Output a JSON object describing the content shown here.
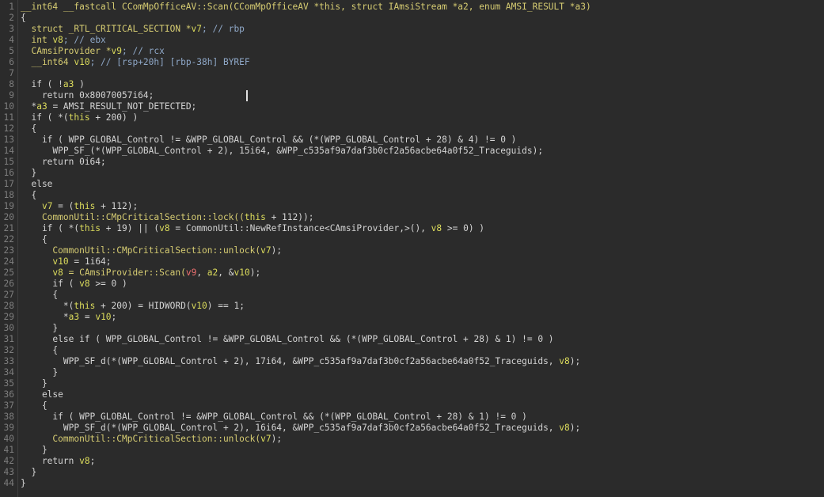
{
  "editor": {
    "colors": {
      "background": "#2b2b2b",
      "default_text": "#d4d4d4",
      "keyword": "#d6cc72",
      "variable": "#dcdc5c",
      "comment": "#8fa8c8",
      "argument": "#f07070",
      "line_number": "#7e7e7e"
    },
    "lines": [
      {
        "num": "1",
        "tokens": [
          {
            "t": "__int64 __fastcall CComMpOfficeAV::Scan(CComMpOfficeAV *this, struct IAmsiStream *a2, enum AMSI_RESULT *a3)",
            "c": "tok-kw"
          }
        ]
      },
      {
        "num": "2",
        "tokens": [
          {
            "t": "{",
            "c": "tok-plain"
          }
        ]
      },
      {
        "num": "3",
        "tokens": [
          {
            "t": "  struct _RTL_CRITICAL_SECTION *",
            "c": "tok-kw"
          },
          {
            "t": "v7",
            "c": "tok-var"
          },
          {
            "t": "; // rbp",
            "c": "tok-comment"
          }
        ]
      },
      {
        "num": "4",
        "tokens": [
          {
            "t": "  int ",
            "c": "tok-kw"
          },
          {
            "t": "v8",
            "c": "tok-var"
          },
          {
            "t": "; // ebx",
            "c": "tok-comment"
          }
        ]
      },
      {
        "num": "5",
        "tokens": [
          {
            "t": "  CAmsiProvider *",
            "c": "tok-kw"
          },
          {
            "t": "v9",
            "c": "tok-var"
          },
          {
            "t": "; // rcx",
            "c": "tok-comment"
          }
        ]
      },
      {
        "num": "6",
        "tokens": [
          {
            "t": "  __int64 ",
            "c": "tok-kw"
          },
          {
            "t": "v10",
            "c": "tok-var"
          },
          {
            "t": "; // [rsp+20h] [rbp-38h] BYREF",
            "c": "tok-comment"
          }
        ]
      },
      {
        "num": "7",
        "tokens": [
          {
            "t": "",
            "c": "tok-plain"
          }
        ]
      },
      {
        "num": "8",
        "tokens": [
          {
            "t": "  if ( !",
            "c": "tok-plain"
          },
          {
            "t": "a3",
            "c": "tok-var"
          },
          {
            "t": " )",
            "c": "tok-plain"
          }
        ]
      },
      {
        "num": "9",
        "tokens": [
          {
            "t": "    return 0x80070057i64;",
            "c": "tok-plain"
          }
        ]
      },
      {
        "num": "10",
        "tokens": [
          {
            "t": "  *",
            "c": "tok-plain"
          },
          {
            "t": "a3",
            "c": "tok-var"
          },
          {
            "t": " = AMSI_RESULT_NOT_DETECTED;",
            "c": "tok-plain"
          }
        ]
      },
      {
        "num": "11",
        "tokens": [
          {
            "t": "  if ( *(",
            "c": "tok-plain"
          },
          {
            "t": "this",
            "c": "tok-var"
          },
          {
            "t": " + 200) )",
            "c": "tok-plain"
          }
        ]
      },
      {
        "num": "12",
        "tokens": [
          {
            "t": "  {",
            "c": "tok-plain"
          }
        ]
      },
      {
        "num": "13",
        "tokens": [
          {
            "t": "    if ( WPP_GLOBAL_Control != &WPP_GLOBAL_Control && (*(WPP_GLOBAL_Control + 28) & 4) != 0 )",
            "c": "tok-plain"
          }
        ]
      },
      {
        "num": "14",
        "tokens": [
          {
            "t": "      WPP_SF_(*(WPP_GLOBAL_Control + 2), 15i64, &WPP_c535af9a7daf3b0cf2a56acbe64a0f52_Traceguids);",
            "c": "tok-plain"
          }
        ]
      },
      {
        "num": "15",
        "tokens": [
          {
            "t": "    return 0i64;",
            "c": "tok-plain"
          }
        ]
      },
      {
        "num": "16",
        "tokens": [
          {
            "t": "  }",
            "c": "tok-plain"
          }
        ]
      },
      {
        "num": "17",
        "tokens": [
          {
            "t": "  else",
            "c": "tok-plain"
          }
        ]
      },
      {
        "num": "18",
        "tokens": [
          {
            "t": "  {",
            "c": "tok-plain"
          }
        ]
      },
      {
        "num": "19",
        "tokens": [
          {
            "t": "    ",
            "c": "tok-plain"
          },
          {
            "t": "v7",
            "c": "tok-var"
          },
          {
            "t": " = (",
            "c": "tok-plain"
          },
          {
            "t": "this",
            "c": "tok-var"
          },
          {
            "t": " + 112);",
            "c": "tok-plain"
          }
        ]
      },
      {
        "num": "20",
        "tokens": [
          {
            "t": "    CommonUtil::CMpCriticalSection::lock((",
            "c": "tok-kw"
          },
          {
            "t": "this",
            "c": "tok-var"
          },
          {
            "t": " + 112));",
            "c": "tok-plain"
          }
        ]
      },
      {
        "num": "21",
        "tokens": [
          {
            "t": "    if ( *(",
            "c": "tok-plain"
          },
          {
            "t": "this",
            "c": "tok-var"
          },
          {
            "t": " + 19) || (",
            "c": "tok-plain"
          },
          {
            "t": "v8",
            "c": "tok-var"
          },
          {
            "t": " = CommonUtil::NewRefInstance<CAmsiProvider,>(), ",
            "c": "tok-plain"
          },
          {
            "t": "v8",
            "c": "tok-var"
          },
          {
            "t": " >= 0) )",
            "c": "tok-plain"
          }
        ]
      },
      {
        "num": "22",
        "tokens": [
          {
            "t": "    {",
            "c": "tok-plain"
          }
        ]
      },
      {
        "num": "23",
        "tokens": [
          {
            "t": "      CommonUtil::CMpCriticalSection::unlock(",
            "c": "tok-kw"
          },
          {
            "t": "v7",
            "c": "tok-var"
          },
          {
            "t": ");",
            "c": "tok-plain"
          }
        ]
      },
      {
        "num": "24",
        "tokens": [
          {
            "t": "      ",
            "c": "tok-plain"
          },
          {
            "t": "v10",
            "c": "tok-var"
          },
          {
            "t": " = 1i64;",
            "c": "tok-plain"
          }
        ]
      },
      {
        "num": "25",
        "tokens": [
          {
            "t": "      ",
            "c": "tok-plain"
          },
          {
            "t": "v8",
            "c": "tok-var"
          },
          {
            "t": " = CAmsiProvider::Scan(",
            "c": "tok-kw"
          },
          {
            "t": "v9",
            "c": "tok-arg"
          },
          {
            "t": ", ",
            "c": "tok-plain"
          },
          {
            "t": "a2",
            "c": "tok-var"
          },
          {
            "t": ", &",
            "c": "tok-plain"
          },
          {
            "t": "v10",
            "c": "tok-var"
          },
          {
            "t": ");",
            "c": "tok-plain"
          }
        ]
      },
      {
        "num": "26",
        "tokens": [
          {
            "t": "      if ( ",
            "c": "tok-plain"
          },
          {
            "t": "v8",
            "c": "tok-var"
          },
          {
            "t": " >= 0 )",
            "c": "tok-plain"
          }
        ]
      },
      {
        "num": "27",
        "tokens": [
          {
            "t": "      {",
            "c": "tok-plain"
          }
        ]
      },
      {
        "num": "28",
        "tokens": [
          {
            "t": "        *(",
            "c": "tok-plain"
          },
          {
            "t": "this",
            "c": "tok-var"
          },
          {
            "t": " + 200) = HIDWORD(",
            "c": "tok-plain"
          },
          {
            "t": "v10",
            "c": "tok-var"
          },
          {
            "t": ") == 1;",
            "c": "tok-plain"
          }
        ]
      },
      {
        "num": "29",
        "tokens": [
          {
            "t": "        *",
            "c": "tok-plain"
          },
          {
            "t": "a3",
            "c": "tok-var"
          },
          {
            "t": " = ",
            "c": "tok-plain"
          },
          {
            "t": "v10",
            "c": "tok-var"
          },
          {
            "t": ";",
            "c": "tok-plain"
          }
        ]
      },
      {
        "num": "30",
        "tokens": [
          {
            "t": "      }",
            "c": "tok-plain"
          }
        ]
      },
      {
        "num": "31",
        "tokens": [
          {
            "t": "      else if ( WPP_GLOBAL_Control != &WPP_GLOBAL_Control && (*(WPP_GLOBAL_Control + 28) & 1) != 0 )",
            "c": "tok-plain"
          }
        ]
      },
      {
        "num": "32",
        "tokens": [
          {
            "t": "      {",
            "c": "tok-plain"
          }
        ]
      },
      {
        "num": "33",
        "tokens": [
          {
            "t": "        WPP_SF_d(*(WPP_GLOBAL_Control + 2), 17i64, &WPP_c535af9a7daf3b0cf2a56acbe64a0f52_Traceguids, ",
            "c": "tok-plain"
          },
          {
            "t": "v8",
            "c": "tok-var"
          },
          {
            "t": ");",
            "c": "tok-plain"
          }
        ]
      },
      {
        "num": "34",
        "tokens": [
          {
            "t": "      }",
            "c": "tok-plain"
          }
        ]
      },
      {
        "num": "35",
        "tokens": [
          {
            "t": "    }",
            "c": "tok-plain"
          }
        ]
      },
      {
        "num": "36",
        "tokens": [
          {
            "t": "    else",
            "c": "tok-plain"
          }
        ]
      },
      {
        "num": "37",
        "tokens": [
          {
            "t": "    {",
            "c": "tok-plain"
          }
        ]
      },
      {
        "num": "38",
        "tokens": [
          {
            "t": "      if ( WPP_GLOBAL_Control != &WPP_GLOBAL_Control && (*(WPP_GLOBAL_Control + 28) & 1) != 0 )",
            "c": "tok-plain"
          }
        ]
      },
      {
        "num": "39",
        "tokens": [
          {
            "t": "        WPP_SF_d(*(WPP_GLOBAL_Control + 2), 16i64, &WPP_c535af9a7daf3b0cf2a56acbe64a0f52_Traceguids, ",
            "c": "tok-plain"
          },
          {
            "t": "v8",
            "c": "tok-var"
          },
          {
            "t": ");",
            "c": "tok-plain"
          }
        ]
      },
      {
        "num": "40",
        "tokens": [
          {
            "t": "      CommonUtil::CMpCriticalSection::unlock(",
            "c": "tok-kw"
          },
          {
            "t": "v7",
            "c": "tok-var"
          },
          {
            "t": ");",
            "c": "tok-plain"
          }
        ]
      },
      {
        "num": "41",
        "tokens": [
          {
            "t": "    }",
            "c": "tok-plain"
          }
        ]
      },
      {
        "num": "42",
        "tokens": [
          {
            "t": "    return ",
            "c": "tok-plain"
          },
          {
            "t": "v8",
            "c": "tok-var"
          },
          {
            "t": ";",
            "c": "tok-plain"
          }
        ]
      },
      {
        "num": "43",
        "tokens": [
          {
            "t": "  }",
            "c": "tok-plain"
          }
        ]
      },
      {
        "num": "44",
        "tokens": [
          {
            "t": "}",
            "c": "tok-plain"
          }
        ]
      }
    ]
  }
}
